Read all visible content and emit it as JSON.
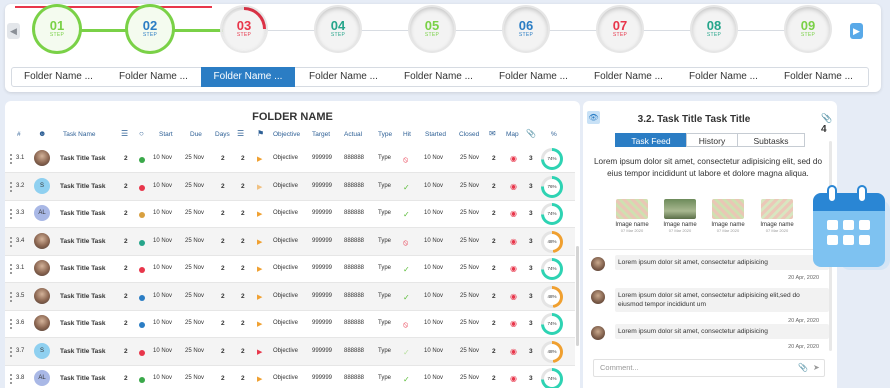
{
  "stepper": {
    "steps": [
      {
        "num": "01",
        "label": "STEP",
        "color": "#7ad147"
      },
      {
        "num": "02",
        "label": "STEP",
        "color": "#2b7dc4"
      },
      {
        "num": "03",
        "label": "STEP",
        "color": "#e8364b"
      },
      {
        "num": "04",
        "label": "STEP",
        "color": "#26a58b"
      },
      {
        "num": "05",
        "label": "STEP",
        "color": "#7ad147"
      },
      {
        "num": "06",
        "label": "STEP",
        "color": "#2b7dc4"
      },
      {
        "num": "07",
        "label": "STEP",
        "color": "#e8364b"
      },
      {
        "num": "08",
        "label": "STEP",
        "color": "#26a58b"
      },
      {
        "num": "09",
        "label": "STEP",
        "color": "#7ad147"
      }
    ],
    "folders": [
      "Folder Name ...",
      "Folder Name ...",
      "Folder Name ...",
      "Folder Name ...",
      "Folder Name ...",
      "Folder Name ...",
      "Folder Name ...",
      "Folder Name ...",
      "Folder Name ..."
    ],
    "active_folder": 2,
    "prev_icon": "chevron-left-icon",
    "next_icon": "chevron-right-icon"
  },
  "table": {
    "title": "FOLDER NAME",
    "headers": {
      "num": "#",
      "task": "Task Name",
      "start": "Start",
      "due": "Due",
      "days": "Days",
      "objective": "Objective",
      "target": "Target",
      "actual": "Actual",
      "type": "Type",
      "hit": "Hit",
      "started": "Started",
      "closed": "Closed",
      "map": "Map",
      "pct": "%"
    },
    "header_icons": [
      "user-icon",
      "subtask-icon",
      "circle-icon",
      "subtask-icon",
      "flag-icon",
      "chat-icon",
      "attachment-icon"
    ],
    "rows": [
      {
        "num": "3.1",
        "avatar": "",
        "name": "Task Title Task",
        "sub": "2",
        "dot": "#3aa84a",
        "start": "10 Nov",
        "due": "25 Nov",
        "days": "2",
        "n2": "2",
        "flag": "#f0a030",
        "objective": "Objective",
        "target": "999999",
        "actual": "888888",
        "type": "Type",
        "hit": "x",
        "started": "10 Nov",
        "closed": "25 Nov",
        "comments": "2",
        "files": "3",
        "pct": "74%",
        "pct_value": 74
      },
      {
        "num": "3.2",
        "avatar": "S",
        "name": "Task Title Task",
        "sub": "2",
        "dot": "#e8364b",
        "start": "10 Nov",
        "due": "25 Nov",
        "days": "2",
        "n2": "2",
        "flag": "#f0c080",
        "objective": "Objective",
        "target": "999999",
        "actual": "888888",
        "type": "Type",
        "hit": "ok",
        "started": "10 Nov",
        "closed": "25 Nov",
        "comments": "2",
        "files": "3",
        "pct": "76%",
        "pct_value": 76
      },
      {
        "num": "3.3",
        "avatar": "AL",
        "name": "Task Title Task",
        "sub": "2",
        "dot": "#d8a040",
        "start": "10 Nov",
        "due": "25 Nov",
        "days": "2",
        "n2": "2",
        "flag": "#f0a030",
        "objective": "Objective",
        "target": "999999",
        "actual": "888888",
        "type": "Type",
        "hit": "ok",
        "started": "10 Nov",
        "closed": "25 Nov",
        "comments": "2",
        "files": "3",
        "pct": "74%",
        "pct_value": 74
      },
      {
        "num": "3.4",
        "avatar": "",
        "name": "Task Title Task",
        "sub": "2",
        "dot": "#26a58b",
        "start": "10 Nov",
        "due": "25 Nov",
        "days": "2",
        "n2": "2",
        "flag": "#f0a030",
        "objective": "Objective",
        "target": "999999",
        "actual": "888888",
        "type": "Type",
        "hit": "x",
        "started": "10 Nov",
        "closed": "25 Nov",
        "comments": "2",
        "files": "3",
        "pct": "48%",
        "pct_value": 48
      },
      {
        "num": "3.1",
        "avatar": "",
        "name": "Task Title Task",
        "sub": "2",
        "dot": "#e8364b",
        "start": "10 Nov",
        "due": "25 Nov",
        "days": "2",
        "n2": "2",
        "flag": "#f0a030",
        "objective": "Objective",
        "target": "999999",
        "actual": "888888",
        "type": "Type",
        "hit": "ok",
        "started": "10 Nov",
        "closed": "25 Nov",
        "comments": "2",
        "files": "3",
        "pct": "74%",
        "pct_value": 74
      },
      {
        "num": "3.5",
        "avatar": "",
        "name": "Task Title Task",
        "sub": "2",
        "dot": "#2b7dc4",
        "start": "10 Nov",
        "due": "25 Nov",
        "days": "2",
        "n2": "2",
        "flag": "#f0a030",
        "objective": "Objective",
        "target": "999999",
        "actual": "888888",
        "type": "Type",
        "hit": "ok",
        "started": "10 Nov",
        "closed": "25 Nov",
        "comments": "2",
        "files": "3",
        "pct": "48%",
        "pct_value": 48
      },
      {
        "num": "3.6",
        "avatar": "",
        "name": "Task Title Task",
        "sub": "2",
        "dot": "#2b7dc4",
        "start": "10 Nov",
        "due": "25 Nov",
        "days": "2",
        "n2": "2",
        "flag": "#f0a030",
        "objective": "Objective",
        "target": "999999",
        "actual": "888888",
        "type": "Type",
        "hit": "x",
        "started": "10 Nov",
        "closed": "25 Nov",
        "comments": "2",
        "files": "3",
        "pct": "74%",
        "pct_value": 74
      },
      {
        "num": "3.7",
        "avatar": "S",
        "name": "Task Title Task",
        "sub": "2",
        "dot": "#e8364b",
        "start": "10 Nov",
        "due": "25 Nov",
        "days": "2",
        "n2": "2",
        "flag": "#e8364b",
        "objective": "Objective",
        "target": "999999",
        "actual": "888888",
        "type": "Type",
        "hit": "ok-light",
        "started": "10 Nov",
        "closed": "25 Nov",
        "comments": "2",
        "files": "3",
        "pct": "48%",
        "pct_value": 48
      },
      {
        "num": "3.8",
        "avatar": "AL",
        "name": "Task Title Task",
        "sub": "2",
        "dot": "#3aa84a",
        "start": "10 Nov",
        "due": "25 Nov",
        "days": "2",
        "n2": "2",
        "flag": "#f0a030",
        "objective": "Objective",
        "target": "999999",
        "actual": "888888",
        "type": "Type",
        "hit": "ok",
        "started": "10 Nov",
        "closed": "25 Nov",
        "comments": "2",
        "files": "3",
        "pct": "74%",
        "pct_value": 74
      }
    ]
  },
  "detail": {
    "title": "3.2. Task Title Task Title",
    "attachments": "4",
    "tabs": [
      "Task Feed",
      "History",
      "Subtasks"
    ],
    "description": "Lorem ipsum dolor sit amet, consectetur adipisicing elit, sed do eius tempor incididunt ut labore et dolore magna aliqua.",
    "images": [
      {
        "name": "Image name",
        "date": "07 Mar 2020"
      },
      {
        "name": "Image name",
        "date": "07 Mar 2020"
      },
      {
        "name": "Image name",
        "date": "07 Mar 2020"
      },
      {
        "name": "Image name",
        "date": "07 Mar 2020"
      }
    ],
    "comments": [
      {
        "text": "Lorem ipsum dolor sit amet, consectetur adipisicing",
        "date": "20 Apr, 2020"
      },
      {
        "text": "Lorem ipsum dolor sit amet, consectetur adipisicing elit,sed do eiusmod tempor incididunt um",
        "date": "20 Apr, 2020"
      },
      {
        "text": "Lorem ipsum dolor sit amet, consectetur adipisicing",
        "date": "20 Apr, 2020"
      }
    ],
    "comment_placeholder": "Comment..."
  }
}
